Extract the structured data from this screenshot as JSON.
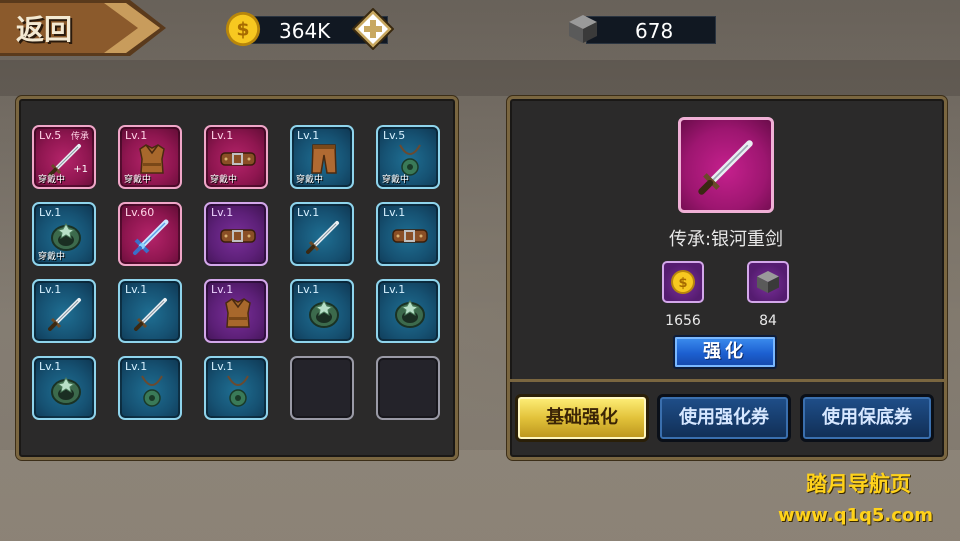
{
  "header": {
    "back_label": "返回",
    "gold_value": "364K",
    "cube_value": "678"
  },
  "inventory": {
    "slots": [
      {
        "level": "Lv.5",
        "rarity": "red",
        "icon": "sword-icon",
        "inherit": "传承",
        "plus": "+1",
        "equipped": "穿戴中"
      },
      {
        "level": "Lv.1",
        "rarity": "red",
        "icon": "armor-icon",
        "equipped": "穿戴中"
      },
      {
        "level": "Lv.1",
        "rarity": "red",
        "icon": "belt-icon",
        "equipped": "穿戴中"
      },
      {
        "level": "Lv.1",
        "rarity": "blue",
        "icon": "pants-icon",
        "equipped": "穿戴中"
      },
      {
        "level": "Lv.5",
        "rarity": "blue",
        "icon": "necklace-icon",
        "equipped": "穿戴中"
      },
      {
        "level": "Lv.1",
        "rarity": "blue",
        "icon": "ring-icon",
        "equipped": "穿戴中"
      },
      {
        "level": "Lv.60",
        "rarity": "red",
        "icon": "blue-sword-icon"
      },
      {
        "level": "Lv.1",
        "rarity": "purple",
        "icon": "belt-icon"
      },
      {
        "level": "Lv.1",
        "rarity": "blue",
        "icon": "sword-icon"
      },
      {
        "level": "Lv.1",
        "rarity": "blue",
        "icon": "belt-icon"
      },
      {
        "level": "Lv.1",
        "rarity": "blue",
        "icon": "sword-icon"
      },
      {
        "level": "Lv.1",
        "rarity": "blue",
        "icon": "sword-icon"
      },
      {
        "level": "Lv.1",
        "rarity": "purple",
        "icon": "armor-icon"
      },
      {
        "level": "Lv.1",
        "rarity": "blue",
        "icon": "ring-icon"
      },
      {
        "level": "Lv.1",
        "rarity": "blue",
        "icon": "ring-icon"
      },
      {
        "level": "Lv.1",
        "rarity": "blue",
        "icon": "ring-icon"
      },
      {
        "level": "Lv.1",
        "rarity": "blue",
        "icon": "necklace-icon"
      },
      {
        "level": "Lv.1",
        "rarity": "blue",
        "icon": "necklace-icon"
      },
      {
        "level": "",
        "rarity": "empty",
        "icon": ""
      },
      {
        "level": "",
        "rarity": "empty",
        "icon": ""
      }
    ]
  },
  "detail": {
    "item_name": "传承:银河重剑",
    "gold_cost": "1656",
    "cube_cost": "84",
    "enhance_label": "强化"
  },
  "actions": {
    "basic_label": "基础强化",
    "coupon_label": "使用强化券",
    "guarantee_label": "使用保底券"
  },
  "watermark": {
    "line1": "踏月导航页",
    "line2": "www.q1q5.com"
  },
  "colors": {
    "panel_border": "#7a6640",
    "rarity_blue": "#165273",
    "rarity_red": "#8f1650",
    "rarity_purple": "#5d2078",
    "watermark": "#ffd21a"
  }
}
